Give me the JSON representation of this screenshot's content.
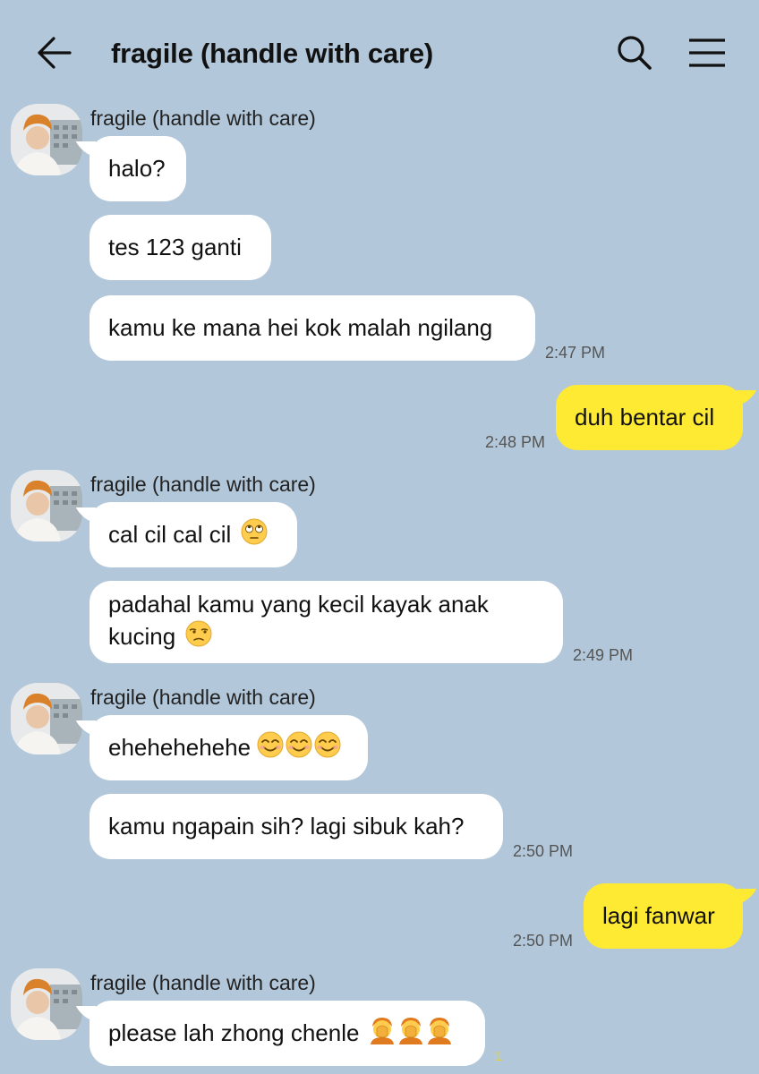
{
  "header": {
    "title": "fragile (handle with care)",
    "back_icon": "arrow-left-icon",
    "search_icon": "search-icon",
    "menu_icon": "hamburger-menu-icon"
  },
  "colors": {
    "background": "#b2c7d9",
    "incoming_bubble": "#ffffff",
    "outgoing_bubble": "#fee933",
    "unread_count": "#e6d328"
  },
  "messages": {
    "g1": {
      "sender": "fragile (handle with care)",
      "m1": "halo?",
      "m2": "tes 123 ganti",
      "m3": "kamu ke mana hei kok malah ngilang",
      "time": "2:47 PM"
    },
    "me1": {
      "text": "duh bentar cil",
      "time": "2:48 PM"
    },
    "g2": {
      "sender": "fragile (handle with care)",
      "m1": "cal cil cal cil",
      "m1_emoji": "face-with-rolling-eyes",
      "m2_line1": "padahal kamu yang kecil kayak anak",
      "m2_line2": "kucing",
      "m2_emoji": "unamused-face",
      "time": "2:49 PM"
    },
    "g3": {
      "sender": "fragile (handle with care)",
      "m1": "ehehehehehe",
      "m1_emoji": "smiling-face x3",
      "m2": "kamu ngapain sih? lagi sibuk kah?",
      "time": "2:50 PM"
    },
    "me2": {
      "text": "lagi fanwar",
      "time": "2:50 PM"
    },
    "g4": {
      "sender": "fragile (handle with care)",
      "m1": "please lah zhong chenle",
      "m1_emoji": "person-facepalming x3",
      "unread": "1"
    }
  }
}
